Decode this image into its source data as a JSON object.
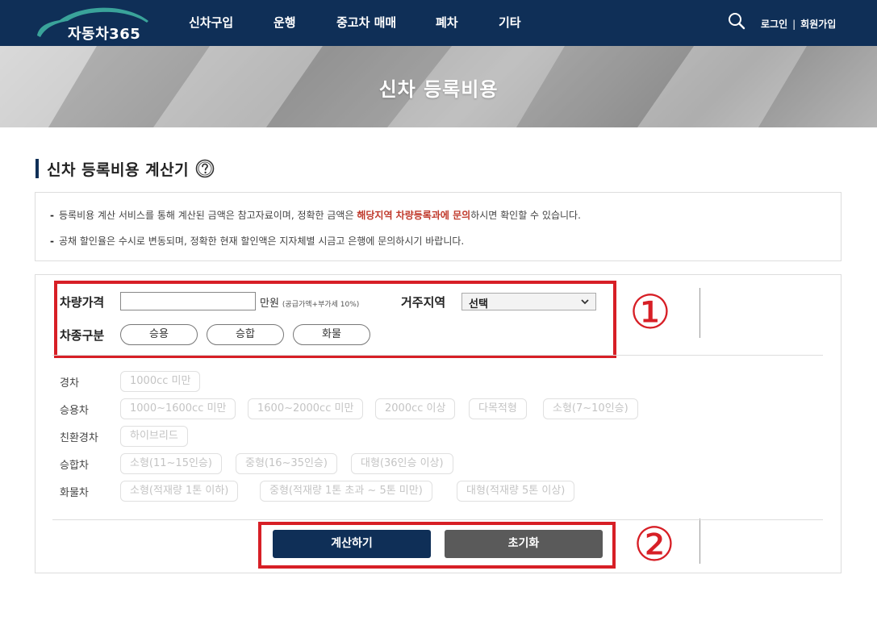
{
  "header": {
    "logo_text": "자동차365",
    "nav": [
      "신차구입",
      "운행",
      "중고차 매매",
      "폐차",
      "기타"
    ],
    "login": "로그인",
    "separator": "|",
    "signup": "회원가입"
  },
  "banner": {
    "title": "신차 등록비용"
  },
  "section": {
    "title": "신차 등록비용 계산기"
  },
  "info": {
    "line1_pre": "등록비용 계산 서비스를 통해 계산된 금액은 참고자료이며, 정확한 금액은 ",
    "line1_highlight": "해당지역 차량등록과에 문의",
    "line1_post": "하시면 확인할 수 있습니다.",
    "line2": "공채 할인율은 수시로 변동되며, 정확한 현재 할인액은 지자체별 시금고 은행에 문의하시기 바랍니다.",
    "dash": "-"
  },
  "form": {
    "price_label": "차량가격",
    "price_value": "",
    "price_unit": "만원",
    "price_note": "(공급가액+부가세 10%)",
    "region_label": "거주지역",
    "region_value": "선택",
    "type_label": "차종구분",
    "type_options": [
      "승용",
      "승합",
      "화물"
    ]
  },
  "categories": [
    {
      "label": "경차",
      "options": [
        "1000cc 미만"
      ]
    },
    {
      "label": "승용차",
      "options": [
        "1000~1600cc 미만",
        "1600~2000cc 미만",
        "2000cc 이상",
        "다목적형",
        "소형(7~10인승)"
      ]
    },
    {
      "label": "친환경차",
      "options": [
        "하이브리드"
      ]
    },
    {
      "label": "승합차",
      "options": [
        "소형(11~15인승)",
        "중형(16~35인승)",
        "대형(36인승 이상)"
      ]
    },
    {
      "label": "화물차",
      "options": [
        "소형(적재량 1톤 이하)",
        "중형(적재량 1톤 초과 ~ 5톤 미만)",
        "대형(적재량 5톤 이상)"
      ]
    }
  ],
  "buttons": {
    "calculate": "계산하기",
    "reset": "초기화"
  },
  "annotations": {
    "marker1": "①",
    "marker2": "②"
  },
  "colors": {
    "navy": "#0f2f57",
    "highlight_red": "#c0392b",
    "frame_red": "#d71f26",
    "reset_gray": "#5a5a5a",
    "logo_teal": "#3aa39a"
  },
  "icons": {
    "search": "search-icon",
    "help": "question-circle-icon",
    "select": "chevron-down-icon"
  }
}
